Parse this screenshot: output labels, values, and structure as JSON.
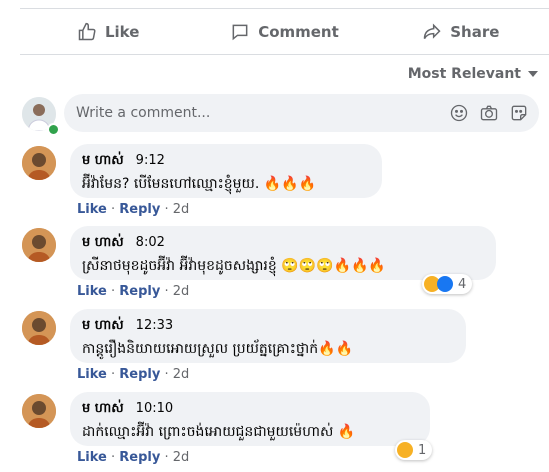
{
  "actions": {
    "like": "Like",
    "comment": "Comment",
    "share": "Share"
  },
  "sort": {
    "label": "Most Relevant"
  },
  "composer": {
    "placeholder": "Write a comment..."
  },
  "comments": [
    {
      "name": "ម ហាស់",
      "time": "9:12",
      "text": "អ៊ីវ៉ាមែន? បើមែនហៅឈ្មោះខ្ញុំមួយ. 🔥🔥🔥",
      "like": "Like",
      "reply": "Reply",
      "age": "2d"
    },
    {
      "name": "ម ហាស់",
      "time": "8:02",
      "text": "ស្រីនាថមុខដូចអ៊ីវ៉ា អ៊ីវ៉ាមុខដូចសង្សារខ្ញុំ 🙄🙄🙄🔥🔥🔥",
      "like": "Like",
      "reply": "Reply",
      "age": "2d",
      "reaction_count": "4"
    },
    {
      "name": "ម ហាស់",
      "time": "12:33",
      "text": "កាន្តូរឿងនិយាយអោយស្រួល ប្រយ័ត្នគ្រោះថ្នាក់🔥🔥",
      "like": "Like",
      "reply": "Reply",
      "age": "2d"
    },
    {
      "name": "ម ហាស់",
      "time": "10:10",
      "text": "ដាក់ឈ្មោះអ៊ីវ៉ា ព្រោះចង់អោយជួនជាមួយម៉េហាស់ 🔥",
      "like": "Like",
      "reply": "Reply",
      "age": "2d",
      "reaction_count": "1"
    }
  ],
  "sep": " · "
}
